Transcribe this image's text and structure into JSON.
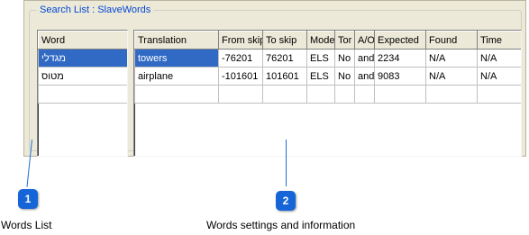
{
  "group_title": "Search List : SlaveWords",
  "words_list": {
    "header": "Word",
    "rows": [
      "מגדלי",
      "מטוס"
    ]
  },
  "info_table": {
    "columns": [
      "Translation",
      "From skip",
      "To skip",
      "Mode",
      "Tor",
      "A/O",
      "Expected",
      "Found",
      "Time"
    ],
    "rows": [
      [
        "towers",
        "-76201",
        "76201",
        "ELS",
        "No",
        "and",
        "2234",
        "N/A",
        "N/A"
      ],
      [
        "airplane",
        "-101601",
        "101601",
        "ELS",
        "No",
        "and",
        "9083",
        "N/A",
        "N/A"
      ]
    ]
  },
  "callouts": [
    {
      "number": "1",
      "caption": "Words List"
    },
    {
      "number": "2",
      "caption": "Words settings and information"
    }
  ]
}
